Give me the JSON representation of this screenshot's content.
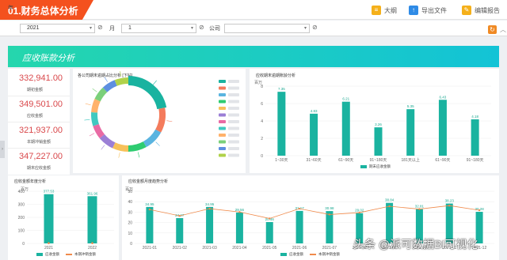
{
  "header": {
    "title": "01.财务总体分析",
    "tools": [
      {
        "icon": "outline-icon",
        "label": "大纲",
        "color": "#f5b01a"
      },
      {
        "icon": "export-icon",
        "label": "导出文件",
        "color": "#2f8be6"
      },
      {
        "icon": "edit-report-icon",
        "label": "编辑报告",
        "color": "#f5b01a"
      }
    ]
  },
  "filters": {
    "year_label": "年",
    "year_value": "2021",
    "month_label": "月",
    "month_value": "1",
    "company_label": "公司",
    "company_value": ""
  },
  "banner": {
    "title": "应收账款分析"
  },
  "kpis": [
    {
      "value": "332,941.00",
      "label": "期初金额"
    },
    {
      "value": "349,501.00",
      "label": "应收金额"
    },
    {
      "value": "321,937.00",
      "label": "本期冲销金额"
    },
    {
      "value": "347,227.00",
      "label": "期末应收金额"
    }
  ],
  "donut_panel": {
    "title": "各公司期末逾期占比分析 [下钻]"
  },
  "watermark": "头条 @派可数据BI可视化",
  "colors": {
    "accent": "#1ab3a0",
    "orange": "#f08a4b",
    "kpi_red": "#d9484b"
  },
  "chart_data": [
    {
      "type": "pie",
      "title": "各公司期末逾期占比分析 [下钻]",
      "slice_colors": [
        "#1ab3a0",
        "#f47b5c",
        "#5ab4e0",
        "#2ecc71",
        "#f7c15a",
        "#9b7fd6",
        "#e96aa4",
        "#40c9c0",
        "#ffb26b",
        "#7bd07a",
        "#5d8fe0",
        "#b0d24a"
      ],
      "values": [
        22,
        11,
        9,
        8,
        7,
        7,
        6,
        6,
        6,
        6,
        6,
        6
      ]
    },
    {
      "type": "bar",
      "title": "应收期末逾期账龄分析",
      "ylabel": "百万",
      "categories": [
        "1~30天",
        "31~60天",
        "61~90天",
        "91~180天",
        "181天以上",
        "61~90天",
        "91~180天"
      ],
      "values": [
        7.35,
        4.83,
        6.21,
        3.26,
        5.35,
        6.43,
        4.18
      ],
      "ylim": [
        0,
        8
      ],
      "yticks": [
        0,
        2,
        4,
        6,
        8
      ],
      "legend": [
        "期末应收金额"
      ]
    },
    {
      "type": "bar",
      "title": "应收金额年度分析",
      "ylabel": "百万",
      "categories": [
        "2021",
        "2022"
      ],
      "series": [
        {
          "name": "应收金额",
          "values": [
            377.53,
            361.96
          ]
        },
        {
          "name": "本期冲销金额",
          "values": [
            2,
            2
          ]
        }
      ],
      "ylim": [
        0,
        400
      ],
      "yticks": [
        0,
        100,
        200,
        300,
        400
      ]
    },
    {
      "type": "bar",
      "title": "应收金额月度趋势分析",
      "ylabel": "百万",
      "categories": [
        "2021-01",
        "2021-02",
        "2021-03",
        "2021-04",
        "2021-05",
        "2021-06",
        "2021-07",
        "2021-08",
        "2021-09",
        "2021-10",
        "2021-11",
        "2021-12"
      ],
      "series": [
        {
          "name": "应收金额",
          "values": [
            34.95,
            24.27,
            34.95,
            29.56,
            20.46,
            31.17,
            30.98,
            29.02,
            38.84,
            32.81,
            38.23,
            30.28
          ]
        },
        {
          "name": "本期冲销金额",
          "values": [
            32.5,
            26.4,
            33.3,
            30.1,
            23.9,
            33.3,
            27.7,
            29.5,
            35.6,
            32.9,
            36.2,
            31.8
          ]
        }
      ],
      "ylim": [
        0,
        50
      ],
      "yticks": [
        0,
        10,
        20,
        30,
        40,
        50
      ]
    }
  ]
}
